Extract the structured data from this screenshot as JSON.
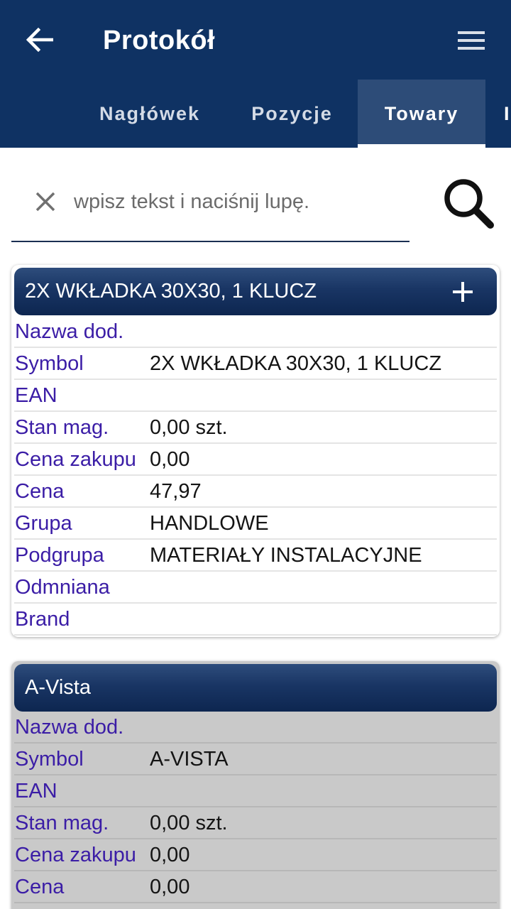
{
  "appbar": {
    "title": "Protokół",
    "back_icon": "arrow-left-icon",
    "menu_icon": "hamburger-menu-icon"
  },
  "tabs": [
    {
      "label": "Nagłówek",
      "active": false
    },
    {
      "label": "Pozycje",
      "active": false
    },
    {
      "label": "Towary",
      "active": true
    }
  ],
  "search": {
    "value": "",
    "placeholder": "wpisz tekst i naciśnij lupę.",
    "clear_icon": "close-icon",
    "search_icon": "magnifier-icon"
  },
  "products": [
    {
      "name": "2X WKŁADKA 30X30, 1 KLUCZ",
      "fields": [
        {
          "label": "Nazwa dod.",
          "value": ""
        },
        {
          "label": "Symbol",
          "value": "2X WKŁADKA 30X30, 1 KLUCZ"
        },
        {
          "label": "EAN",
          "value": ""
        },
        {
          "label": "Stan mag.",
          "value": "0,00 szt."
        },
        {
          "label": "Cena zakupu",
          "value": "0,00"
        },
        {
          "label": "Cena",
          "value": "47,97"
        },
        {
          "label": "Grupa",
          "value": "HANDLOWE"
        },
        {
          "label": "Podgrupa",
          "value": "MATERIAŁY INSTALACYJNE"
        },
        {
          "label": "Odmniana",
          "value": ""
        },
        {
          "label": "Brand",
          "value": ""
        }
      ]
    },
    {
      "name": "A-Vista",
      "fields": [
        {
          "label": "Nazwa dod.",
          "value": ""
        },
        {
          "label": "Symbol",
          "value": "A-VISTA"
        },
        {
          "label": "EAN",
          "value": ""
        },
        {
          "label": "Stan mag.",
          "value": "0,00 szt."
        },
        {
          "label": "Cena zakupu",
          "value": "0,00"
        },
        {
          "label": "Cena",
          "value": "0,00"
        }
      ]
    }
  ],
  "colors": {
    "appbar": "#0f3263",
    "tab_active": "#2d4c78",
    "label": "#3b1da6"
  }
}
